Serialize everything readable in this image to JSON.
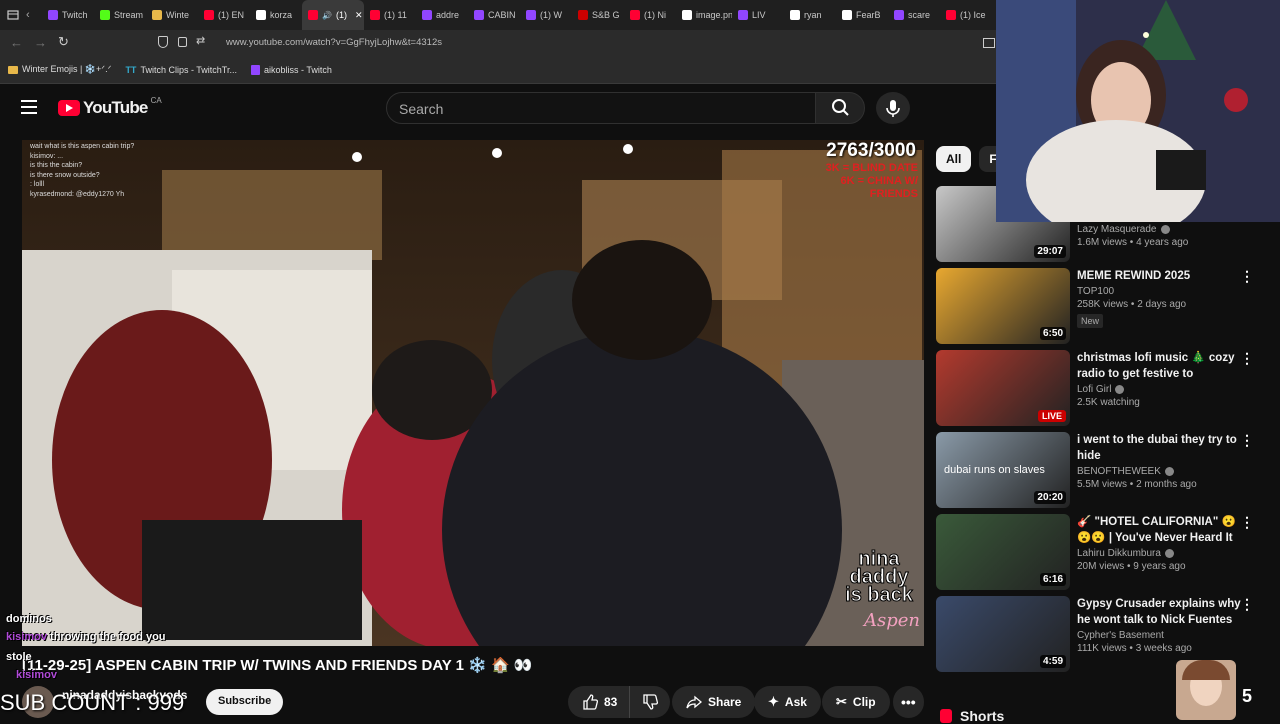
{
  "tabs": [
    {
      "label": "Twitch",
      "color": "#9146ff"
    },
    {
      "label": "Stream",
      "color": "#53fc18"
    },
    {
      "label": "Winte",
      "color": "#e8b84a"
    },
    {
      "label": "(1) EN",
      "color": "#ff0033"
    },
    {
      "label": "korza",
      "color": "#ffffff"
    },
    {
      "label": "(1)",
      "color": "#ff0033"
    },
    {
      "label": "(1) 11",
      "color": "#ff0033"
    },
    {
      "label": "addre",
      "color": "#9146ff"
    },
    {
      "label": "CABIN",
      "color": "#9146ff"
    },
    {
      "label": "(1) W",
      "color": "#9146ff"
    },
    {
      "label": "S&B G",
      "color": "#cc0000"
    },
    {
      "label": "(1) Ni",
      "color": "#ff0033"
    },
    {
      "label": "image.png",
      "color": "#ffffff"
    },
    {
      "label": "LIV",
      "color": "#9146ff"
    },
    {
      "label": "ryan",
      "color": "#ffffff"
    },
    {
      "label": "FearB",
      "color": "#ffffff"
    },
    {
      "label": "scare",
      "color": "#9146ff"
    },
    {
      "label": "(1) Ice",
      "color": "#ff0033"
    }
  ],
  "address_bar": {
    "url": "www.youtube.com/watch?v=GgFhyjLojhw&t=4312s"
  },
  "bookmarks": [
    {
      "label": "Winter Emojis | ❄️+ᐟ.ᐟ",
      "icon": "folder-icon"
    },
    {
      "label": "Twitch Clips - TwitchTr...",
      "icon": "tt-icon"
    },
    {
      "label": "aikobliss - Twitch",
      "icon": "twitch-icon"
    }
  ],
  "youtube": {
    "logo_text": "YouTube",
    "region": "CA",
    "search_placeholder": "Search"
  },
  "video_overlay": {
    "chat_lines": [
      "wait what is this aspen cabin trip?",
      "kisimov: ...",
      "is this the cabin?",
      "is there snow outside?",
      ": lolll",
      "kyrasedmond: @eddy1270 Yh"
    ],
    "counter": "2763/3000",
    "goal_lines": [
      "3K = BLIND DATE",
      "6K = CHINA W/",
      "FRIENDS"
    ],
    "watermark": "nina daddy is back",
    "watermark_sub": "Aspen"
  },
  "stream_overlay": {
    "chat_word": "dominos",
    "chat_user": "kisimov",
    "chat_text": "throwing the food you",
    "chat_word2": "stole",
    "chat_user2": "kisimov",
    "sub_count_label": "SUB COUNT : 999",
    "corner_number": "5"
  },
  "video_info": {
    "title": "[11-29-25] ASPEN CABIN TRIP W/ TWINS AND FRIENDS DAY 1 ❄️ 🏠 👀",
    "channel": "ninadaddyisbackyods",
    "subscribe_label": "Subscribe",
    "likes": "83",
    "share_label": "Share",
    "ask_label": "Ask",
    "clip_label": "Clip"
  },
  "sidebar": {
    "chips": [
      "All",
      "Fr"
    ],
    "recommendations": [
      {
        "title": "",
        "channel": "Lazy Masquerade",
        "verified": true,
        "stats": "1.6M views • 4 years ago",
        "duration": "29:07",
        "live": false,
        "new": false,
        "thumb_color": "#c8c8c8"
      },
      {
        "title": "MEME REWIND 2025",
        "channel": "TOP100",
        "verified": false,
        "stats": "258K views • 2 days ago",
        "duration": "6:50",
        "live": false,
        "new": true,
        "new_label": "New",
        "thumb_color": "#e8a830"
      },
      {
        "title": "christmas lofi music 🎄 cozy radio to get festive to",
        "channel": "Lofi Girl",
        "verified": true,
        "stats": "2.5K watching",
        "duration": "",
        "live": true,
        "live_label": "LIVE",
        "new": false,
        "thumb_color": "#b33a2e"
      },
      {
        "title": "i went to the dubai they try to hide",
        "channel": "BENOFTHEWEEK",
        "verified": true,
        "stats": "5.5M views • 2 months ago",
        "duration": "20:20",
        "live": false,
        "new": false,
        "thumb_color": "#8a9aa8",
        "thumb_caption": "dubai runs on slaves"
      },
      {
        "title": "🎸 \"HOTEL CALIFORNIA\" 😮😮😮 | You've Never Heard It Lik...",
        "channel": "Lahiru Dikkumbura",
        "verified": true,
        "stats": "20M views • 9 years ago",
        "duration": "6:16",
        "live": false,
        "new": false,
        "thumb_color": "#3a5a3a"
      },
      {
        "title": "Gypsy Crusader explains why he wont talk to Nick Fuentes whil...",
        "channel": "Cypher's Basement",
        "verified": false,
        "stats": "111K views • 3 weeks ago",
        "duration": "4:59",
        "live": false,
        "new": false,
        "thumb_color": "#3a4a6a"
      }
    ],
    "shorts_label": "Shorts"
  }
}
